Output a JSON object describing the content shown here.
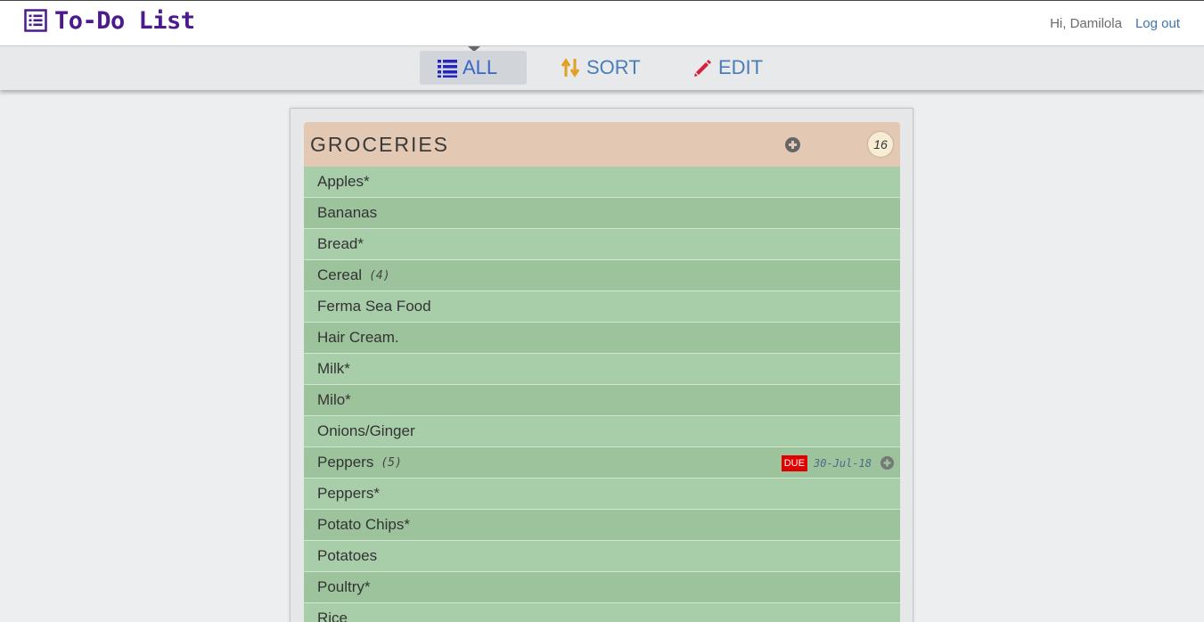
{
  "app": {
    "title": "To-Do List",
    "greeting": "Hi, Damilola",
    "logout_label": "Log out",
    "brand_color": "#4b1a8c"
  },
  "nav": {
    "items": [
      {
        "label": "ALL",
        "icon": "list-icon",
        "active": true
      },
      {
        "label": "SORT",
        "icon": "sort-icon",
        "active": false
      },
      {
        "label": "EDIT",
        "icon": "pencil-icon",
        "active": false
      }
    ]
  },
  "list": {
    "title": "GROCERIES",
    "count": "16",
    "header_color": "#e3c9b3",
    "items": [
      {
        "name": "Apples*",
        "qty": ""
      },
      {
        "name": "Bananas",
        "qty": ""
      },
      {
        "name": "Bread*",
        "qty": ""
      },
      {
        "name": "Cereal",
        "qty": "(4)"
      },
      {
        "name": "Ferma Sea Food",
        "qty": ""
      },
      {
        "name": "Hair Cream.",
        "qty": ""
      },
      {
        "name": "Milk*",
        "qty": ""
      },
      {
        "name": "Milo*",
        "qty": ""
      },
      {
        "name": "Onions/Ginger",
        "qty": ""
      },
      {
        "name": "Peppers",
        "qty": "(5)",
        "due_label": "DUE",
        "due_date": "30-Jul-18"
      },
      {
        "name": "Peppers*",
        "qty": ""
      },
      {
        "name": "Potato Chips*",
        "qty": ""
      },
      {
        "name": "Potatoes",
        "qty": ""
      },
      {
        "name": "Poultry*",
        "qty": ""
      },
      {
        "name": "Rice",
        "qty": ""
      }
    ]
  }
}
